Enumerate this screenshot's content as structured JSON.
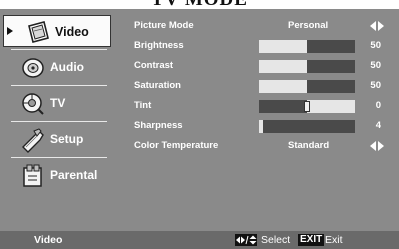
{
  "screen_title": "TV MODE",
  "sidebar": {
    "items": [
      {
        "label": "Video",
        "icon": "tv-screen-icon",
        "active": true
      },
      {
        "label": "Audio",
        "icon": "speaker-icon"
      },
      {
        "label": "TV",
        "icon": "antenna-icon"
      },
      {
        "label": "Setup",
        "icon": "wrench-icon"
      },
      {
        "label": "Parental",
        "icon": "lock-icon"
      }
    ]
  },
  "settings": [
    {
      "name": "Picture Mode",
      "type": "select",
      "value": "Personal"
    },
    {
      "name": "Brightness",
      "type": "slider",
      "value": "50",
      "level": 50
    },
    {
      "name": "Contrast",
      "type": "slider",
      "value": "50",
      "level": 50
    },
    {
      "name": "Saturation",
      "type": "slider",
      "value": "50",
      "level": 50
    },
    {
      "name": "Tint",
      "type": "center-slider",
      "value": "0",
      "level": 0
    },
    {
      "name": "Sharpness",
      "type": "slider",
      "value": "4",
      "level": 4
    },
    {
      "name": "Color Temperature",
      "type": "select",
      "value": "Standard"
    }
  ],
  "footer": {
    "current_menu": "Video",
    "select_label": "Select",
    "exit_key": "EXIT",
    "exit_label": "Exit"
  },
  "colors": {
    "panel": "#8a8a8a",
    "footer": "#6a6a6a",
    "bar_track": "#e6e6e6",
    "bar_fill": "#4a4a4a"
  }
}
